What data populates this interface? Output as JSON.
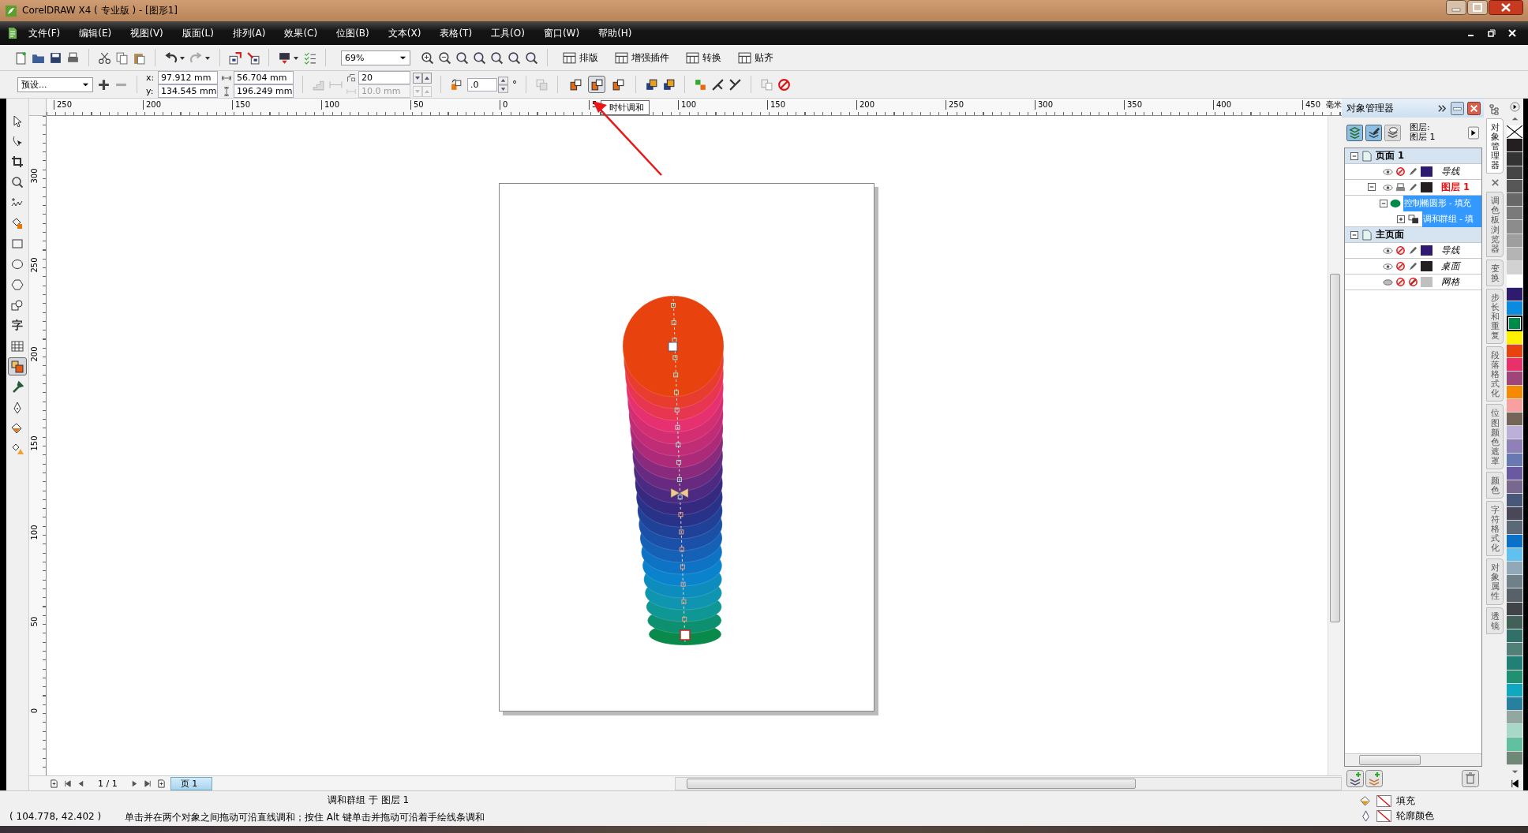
{
  "window": {
    "title": "CorelDRAW X4 ( 专业版 ) - [图形1]"
  },
  "menu": [
    {
      "label": "文件(F)"
    },
    {
      "label": "编辑(E)"
    },
    {
      "label": "视图(V)"
    },
    {
      "label": "版面(L)"
    },
    {
      "label": "排列(A)"
    },
    {
      "label": "效果(C)"
    },
    {
      "label": "位图(B)"
    },
    {
      "label": "文本(X)"
    },
    {
      "label": "表格(T)"
    },
    {
      "label": "工具(O)"
    },
    {
      "label": "窗口(W)"
    },
    {
      "label": "帮助(H)"
    }
  ],
  "standard_toolbar": {
    "zoom": "69%",
    "buttons": [
      {
        "label": "排版"
      },
      {
        "label": "增强插件"
      },
      {
        "label": "转换"
      },
      {
        "label": "贴齐"
      }
    ]
  },
  "property_bar": {
    "preset": "预设...",
    "x_label": "x:",
    "x": "97.912 mm",
    "y_label": "y:",
    "y": "134.545 mm",
    "width": "56.704 mm",
    "height": "196.249 mm",
    "steps": "20",
    "spacing": "10.0 mm",
    "spacing_disabled": true,
    "rotation": ".0",
    "degree": "°",
    "direction": [
      {
        "selected": false
      },
      {
        "selected": true
      },
      {
        "selected": false
      }
    ]
  },
  "toolbox": [
    {
      "kind": "pick",
      "selected": false
    },
    {
      "kind": "shape",
      "selected": false
    },
    {
      "kind": "crop",
      "selected": false
    },
    {
      "kind": "zoom",
      "selected": false
    },
    {
      "kind": "freehand",
      "selected": false
    },
    {
      "kind": "smart",
      "selected": false
    },
    {
      "kind": "rectangle",
      "selected": false
    },
    {
      "kind": "ellipse",
      "selected": false
    },
    {
      "kind": "polygon",
      "selected": false
    },
    {
      "kind": "shapes",
      "selected": false
    },
    {
      "kind": "text",
      "label": "字",
      "selected": false
    },
    {
      "kind": "table",
      "selected": false
    },
    {
      "kind": "blend",
      "selected": true
    },
    {
      "kind": "eyedropper",
      "selected": false
    },
    {
      "kind": "outline",
      "selected": false
    },
    {
      "kind": "fill",
      "selected": false
    },
    {
      "kind": "interactive",
      "selected": false
    }
  ],
  "rulers": {
    "horizontal": [
      "250",
      "200",
      "150",
      "100",
      "50",
      "0",
      "5",
      "100",
      "150",
      "200",
      "250",
      "300",
      "350",
      "400",
      "450"
    ],
    "unit": "毫米",
    "vertical": [
      "300",
      "250",
      "200",
      "150",
      "100",
      "50",
      "0"
    ]
  },
  "tooltip": "时针调和",
  "page_nav": {
    "count": "1 / 1",
    "tab": "页 1"
  },
  "object_manager": {
    "title": "对象管理器",
    "layer_label": "图层:",
    "layer_value": "图层 1",
    "pages": [
      {
        "name": "页面 1",
        "expanded": true,
        "layers": [
          {
            "name": "导线",
            "visible": true,
            "printable": false,
            "editable": true,
            "color": "#2e1a6e",
            "active": false
          },
          {
            "name": "图层 1",
            "visible": true,
            "printable": true,
            "editable": true,
            "color": "#231f20",
            "active": true,
            "expanded": true,
            "children": [
              {
                "name": "控制椭圆形 - 填充",
                "selected": true,
                "expanded": true,
                "children": [
                  {
                    "name": "调和群组 - 填",
                    "selected": true,
                    "expanded": false
                  }
                ]
              }
            ]
          }
        ]
      },
      {
        "name": "主页面",
        "expanded": true,
        "layers": [
          {
            "name": "导线",
            "visible": true,
            "printable": false,
            "editable": true,
            "color": "#2e1a6e",
            "active": false
          },
          {
            "name": "桌面",
            "visible": true,
            "printable": false,
            "editable": true,
            "color": "#231f20",
            "active": false
          },
          {
            "name": "网格",
            "visible": false,
            "printable": false,
            "editable": false,
            "color": "#c0c0c0",
            "active": false
          }
        ]
      }
    ]
  },
  "docker_tabs": [
    {
      "label": "对象管理器",
      "selected": true
    },
    {
      "label": "调色板浏览器",
      "selected": false
    },
    {
      "label": "变换",
      "selected": false
    },
    {
      "label": "步长和重复",
      "selected": false
    },
    {
      "label": "段落格式化",
      "selected": false
    },
    {
      "label": "位图颜色遮罩",
      "selected": false
    },
    {
      "label": "颜色",
      "selected": false
    },
    {
      "label": "字符格式化",
      "selected": false
    },
    {
      "label": "对象属性",
      "selected": false
    },
    {
      "label": "透镜",
      "selected": false
    }
  ],
  "palette": [
    {
      "kind": "none",
      "selected": false
    },
    {
      "kind": "color",
      "color": "#231f20",
      "selected": false
    },
    {
      "kind": "color",
      "color": "#333333",
      "selected": false
    },
    {
      "kind": "color",
      "color": "#454545",
      "selected": false
    },
    {
      "kind": "color",
      "color": "#575757",
      "selected": false
    },
    {
      "kind": "color",
      "color": "#686868",
      "selected": false
    },
    {
      "kind": "color",
      "color": "#7a7a7a",
      "selected": false
    },
    {
      "kind": "color",
      "color": "#8c8c8c",
      "selected": false
    },
    {
      "kind": "color",
      "color": "#9e9e9e",
      "selected": false
    },
    {
      "kind": "color",
      "color": "#b4b4b4",
      "selected": false
    },
    {
      "kind": "color",
      "color": "#d2d2d2",
      "selected": false
    },
    {
      "kind": "color",
      "color": "#ffffff",
      "selected": false
    },
    {
      "kind": "color",
      "color": "#2e1a6e",
      "selected": false
    },
    {
      "kind": "color",
      "color": "#0a8be0",
      "selected": false
    },
    {
      "kind": "color",
      "color": "#008a4a",
      "selected": true
    },
    {
      "kind": "color",
      "color": "#fff200",
      "selected": false
    },
    {
      "kind": "color",
      "color": "#e8420e",
      "selected": false
    },
    {
      "kind": "color",
      "color": "#e8306a",
      "selected": false
    },
    {
      "kind": "color",
      "color": "#a0457a",
      "selected": false
    },
    {
      "kind": "color",
      "color": "#f58a00",
      "selected": false
    },
    {
      "kind": "color",
      "color": "#f8a0a0",
      "selected": false
    },
    {
      "kind": "color",
      "color": "#756458",
      "selected": false
    },
    {
      "kind": "color",
      "color": "#bcb0d8",
      "selected": false
    },
    {
      "kind": "color",
      "color": "#9080b8",
      "selected": false
    },
    {
      "kind": "color",
      "color": "#6878b0",
      "selected": false
    },
    {
      "kind": "color",
      "color": "#6a58a0",
      "selected": false
    },
    {
      "kind": "color",
      "color": "#786890",
      "selected": false
    },
    {
      "kind": "color",
      "color": "#485878",
      "selected": false
    },
    {
      "kind": "color",
      "color": "#4a4858",
      "selected": false
    },
    {
      "kind": "color",
      "color": "#5a6878",
      "selected": false
    },
    {
      "kind": "color",
      "color": "#0a70c8",
      "selected": false
    },
    {
      "kind": "color",
      "color": "#60c0f0",
      "selected": false
    },
    {
      "kind": "color",
      "color": "#90a8b8",
      "selected": false
    },
    {
      "kind": "color",
      "color": "#708088",
      "selected": false
    },
    {
      "kind": "color",
      "color": "#586068",
      "selected": false
    },
    {
      "kind": "color",
      "color": "#404448",
      "selected": false
    },
    {
      "kind": "color",
      "color": "#406058",
      "selected": false
    },
    {
      "kind": "color",
      "color": "#307068",
      "selected": false
    },
    {
      "kind": "color",
      "color": "#508078",
      "selected": false
    },
    {
      "kind": "color",
      "color": "#208078",
      "selected": false
    },
    {
      "kind": "color",
      "color": "#209070",
      "selected": false
    },
    {
      "kind": "color",
      "color": "#10a8c0",
      "selected": false
    },
    {
      "kind": "color",
      "color": "#2880a0",
      "selected": false
    },
    {
      "kind": "color",
      "color": "#90a8a0",
      "selected": false
    },
    {
      "kind": "color",
      "color": "#a8d8c8",
      "selected": false
    },
    {
      "kind": "color",
      "color": "#60c0a0",
      "selected": false
    },
    {
      "kind": "color",
      "color": "#708878",
      "selected": false
    }
  ],
  "status": {
    "object": "调和群组 于 图层 1",
    "coords": "( 104.778, 42.402 )",
    "hint": "单击并在两个对象之间拖动可沿直线调和；按住 Alt 键单击并拖动可沿着手绘线条调和",
    "fill_label": "填充",
    "outline_label": "轮廓颜色"
  }
}
